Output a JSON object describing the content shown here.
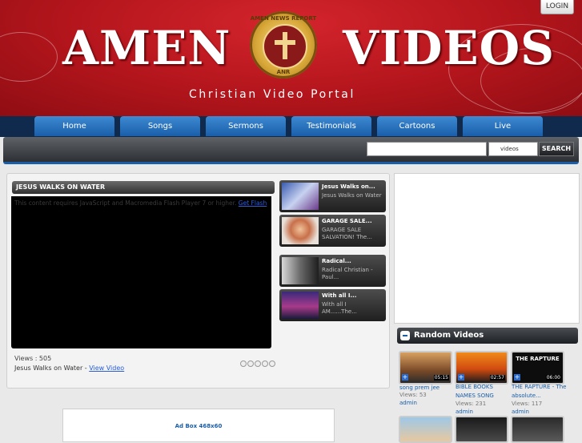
{
  "header": {
    "brand_left": "AMEN",
    "brand_right": "VIDEOS",
    "seal_top": "AMEN NEWS REPORT",
    "seal_bottom": "ANR",
    "tagline": "Christian Video Portal",
    "login_label": "LOGIN"
  },
  "nav": {
    "items": [
      {
        "label": "Home"
      },
      {
        "label": "Songs"
      },
      {
        "label": "Sermons"
      },
      {
        "label": "Testimonials"
      },
      {
        "label": "Cartoons"
      },
      {
        "label": "Live"
      }
    ]
  },
  "search": {
    "value": "",
    "selected_option": "videos",
    "button_label": "SEARCH"
  },
  "player": {
    "title": "JESUS WALKS ON WATER",
    "flash_message": "This content requires JavaScript and Macromedia Flash Player 7 or higher.",
    "flash_link": "Get Flash",
    "views": "Views : 505",
    "caption_text": "Jesus Walks on Water - ",
    "caption_link": "View Video"
  },
  "related": [
    {
      "title": "Jesus Walks on...",
      "desc": "Jesus Walks on Water"
    },
    {
      "title": "GARAGE SALE...",
      "desc": "GARAGE SALE SALVATION! The..."
    },
    {
      "title": "Radical...",
      "desc": "Radical Christian - Paul..."
    },
    {
      "title": "With all I...",
      "desc": "With all I AM......The..."
    }
  ],
  "random": {
    "heading": "Random Videos",
    "items": [
      {
        "title": "song prem jee",
        "views": "Views: 53",
        "author": "admin",
        "duration": "05:15",
        "thumb_text": ""
      },
      {
        "title": "BIBLE BOOKS NAMES SONG",
        "views": "Views: 231",
        "author": "admin",
        "duration": "02:57",
        "thumb_text": ""
      },
      {
        "title": "THE RAPTURE - The absolute...",
        "views": "Views: 117",
        "author": "admin",
        "duration": "06:00",
        "thumb_text": "THE RAPTURE"
      }
    ]
  },
  "ad_bottom": {
    "label": "Ad Box 468x60"
  },
  "colors": {
    "header_red": "#b3151c",
    "nav_blue": "#1a5ea9",
    "link_blue": "#2a5ed8"
  }
}
